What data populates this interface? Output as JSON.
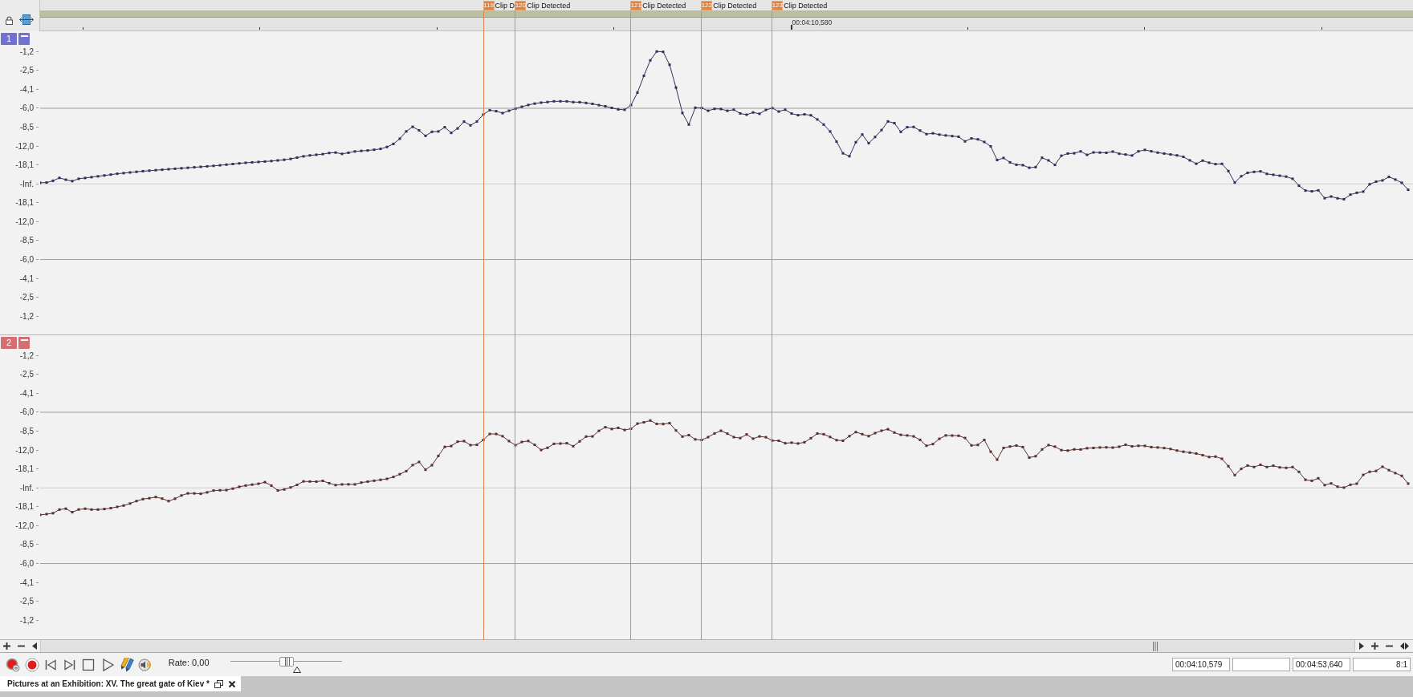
{
  "markers": [
    {
      "number": "119",
      "label": "Clip D"
    },
    {
      "number": "120",
      "label": "Clip Detected"
    },
    {
      "number": "121",
      "label": "Clip Detected"
    },
    {
      "number": "122",
      "label": "Clip Detected"
    },
    {
      "number": "123",
      "label": "Clip Detected"
    }
  ],
  "ruler": {
    "timecode": "00:04:10,580"
  },
  "channels": [
    {
      "number": "1",
      "color": "#7171d1",
      "axis_labels": [
        "-1,2",
        "-2,5",
        "-4,1",
        "-6,0",
        "-8,5",
        "-12,0",
        "-18,1",
        "-Inf.",
        "-18,1",
        "-12,0",
        "-8,5",
        "-6,0",
        "-4,1",
        "-2,5",
        "-1,2"
      ]
    },
    {
      "number": "2",
      "color": "#d56f6f",
      "axis_labels": [
        "-1,2",
        "-2,5",
        "-4,1",
        "-6,0",
        "-8,5",
        "-12,0",
        "-18,1",
        "-Inf.",
        "-18,1",
        "-12,0",
        "-8,5",
        "-6,0",
        "-4,1",
        "-2,5",
        "-1,2"
      ]
    }
  ],
  "transport": {
    "rate": "Rate: 0,00",
    "rate_slider": {
      "level": 0.5
    }
  },
  "fields": [
    {
      "kind": "time",
      "value": "00:04:10,579"
    },
    {
      "kind": "blank"
    },
    {
      "kind": "time",
      "value": "00:04:53,640"
    },
    {
      "kind": "ratio",
      "value": "8:1"
    }
  ],
  "tabs": [
    {
      "title": "Pictures at an Exhibition: XV. The great gate of Kiev *",
      "selected": true
    }
  ]
}
